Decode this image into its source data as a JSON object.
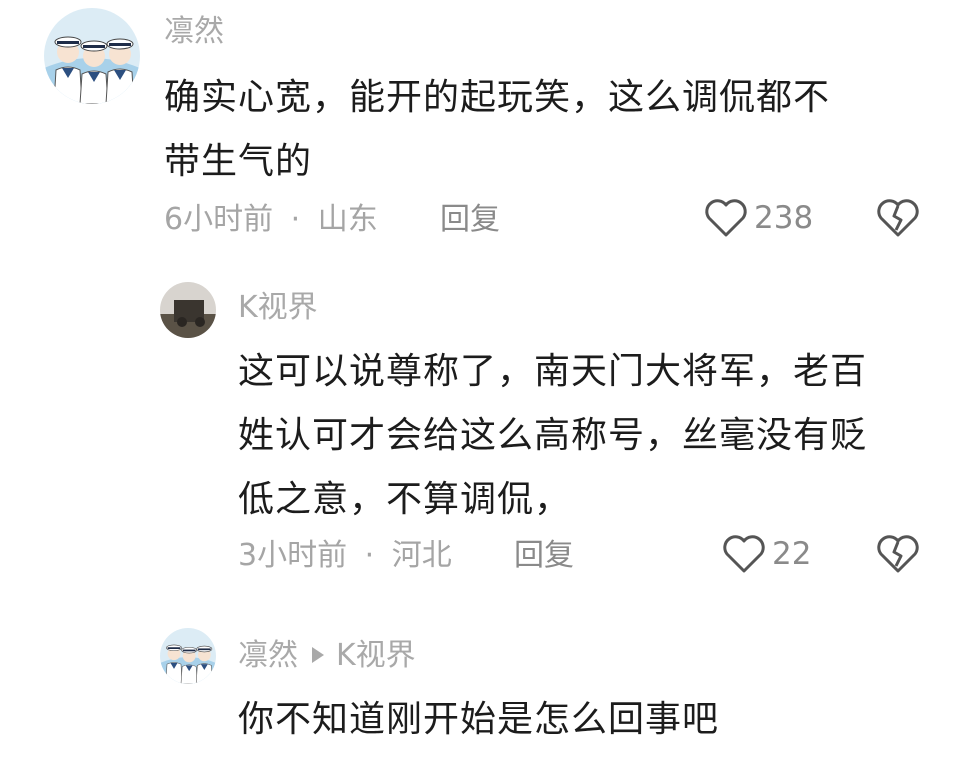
{
  "comments": [
    {
      "username": "凛然",
      "lines": [
        "确实心宽，能开的起玩笑，这么调侃都不",
        "带生气的"
      ],
      "time": "6小时前",
      "location": "山东",
      "reply_label": "回复",
      "likes": "238"
    },
    {
      "username": "K视界",
      "lines": [
        "这可以说尊称了，南天门大将军，老百",
        "姓认可才会给这么高称号，丝毫没有贬",
        "低之意，不算调侃，"
      ],
      "time": "3小时前",
      "location": "河北",
      "reply_label": "回复",
      "likes": "22"
    },
    {
      "username": "凛然",
      "reply_to": "K视界",
      "lines": [
        "你不知道刚开始是怎么回事吧"
      ]
    }
  ],
  "separator": "·",
  "icons": {
    "like": "heart-outline-icon",
    "dislike": "broken-heart-icon",
    "reply_arrow": "play-arrow-icon"
  },
  "colors": {
    "username": "#a9a9a9",
    "body": "#1c1c1c",
    "meta": "#a5a5a5"
  }
}
